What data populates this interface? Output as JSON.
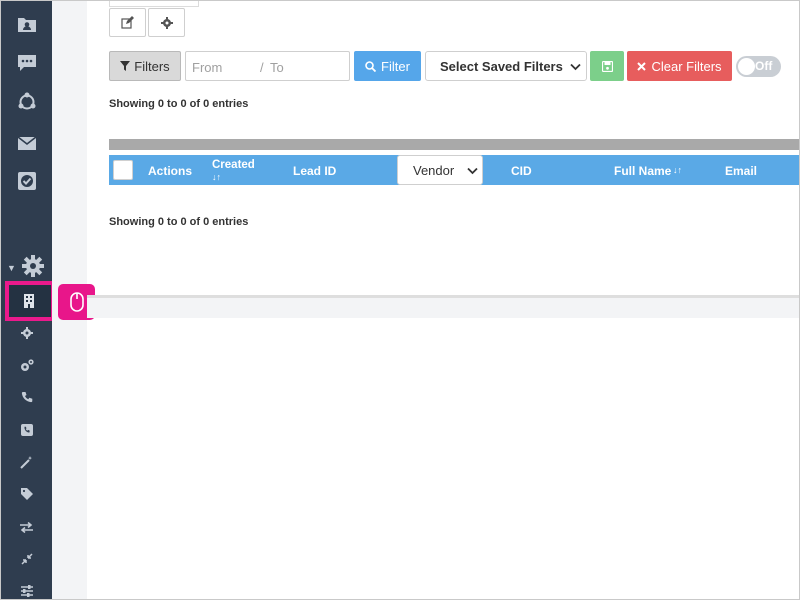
{
  "sidebar": {
    "icons": [
      {
        "name": "contacts-folder-icon"
      },
      {
        "name": "chat-icon"
      },
      {
        "name": "integrations-icon"
      },
      {
        "name": "mail-icon"
      },
      {
        "name": "tasks-icon"
      },
      {
        "name": "settings-gear-icon"
      },
      {
        "name": "building-icon"
      },
      {
        "name": "gear-icon"
      },
      {
        "name": "gears-icon"
      },
      {
        "name": "phone-icon"
      },
      {
        "name": "phone-square-icon"
      },
      {
        "name": "magic-wand-icon"
      },
      {
        "name": "tag-icon"
      },
      {
        "name": "exchange-icon"
      },
      {
        "name": "compress-icon"
      },
      {
        "name": "sliders-icon"
      }
    ],
    "highlighted": "building-icon"
  },
  "toolbar": {
    "filters_label": "Filters",
    "date_from_placeholder": "From",
    "date_separator": "/",
    "date_to_placeholder": "To",
    "filter_button_label": "Filter",
    "saved_filters_label": "Select Saved Filters",
    "clear_filters_label": "Clear Filters",
    "toggle_label": "Off"
  },
  "table": {
    "showing_top": "Showing 0 to 0 of 0 entries",
    "showing_bottom": "Showing 0 to 0 of 0 entries",
    "columns": {
      "actions": "Actions",
      "created": "Created",
      "created_sort": "↓↑",
      "lead_id": "Lead ID",
      "vendor": "Vendor",
      "cid": "CID",
      "full_name": "Full Name",
      "full_name_sort": "↓↑",
      "email": "Email"
    }
  },
  "colors": {
    "sidebar_bg": "#2f3d4f",
    "accent_blue": "#5aa9e6",
    "highlight_pink": "#ea1a8c",
    "save_green": "#7ccf8a",
    "clear_red": "#e75d5d"
  }
}
